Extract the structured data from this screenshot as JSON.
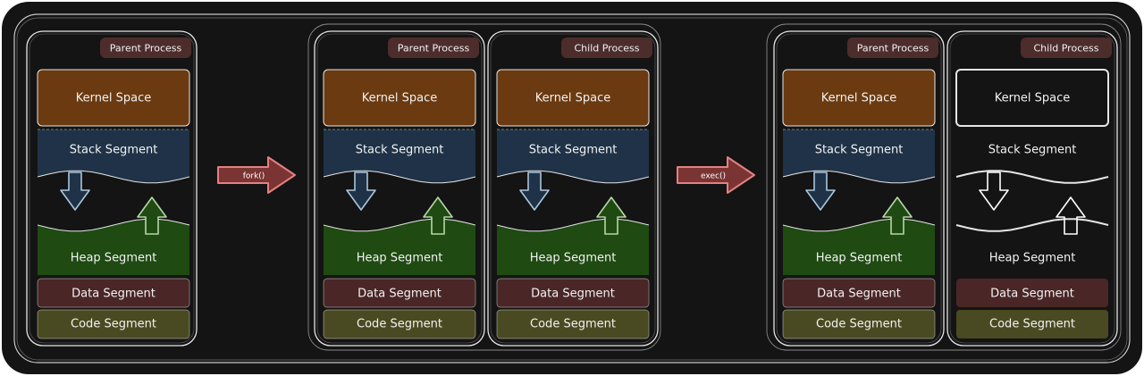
{
  "colors": {
    "background": "#141414",
    "stroke": "#e6e6e6",
    "kernel": "#6b3a10",
    "stack": "#1f3247",
    "heap": "#1f4a12",
    "data": "#4a2626",
    "code": "#4a4a22",
    "tag": "#4d2c2c",
    "arrow_fill": "#7a3434",
    "arrow_stroke": "#e58080",
    "down_arrow": "#a9c6de",
    "up_arrow": "#b6d6a8"
  },
  "tags": {
    "parent": "Parent Process",
    "child": "Child Process"
  },
  "segments": {
    "kernel": "Kernel Space",
    "stack": "Stack Segment",
    "heap": "Heap Segment",
    "data": "Data Segment",
    "code": "Code Segment"
  },
  "transitions": {
    "fork": "fork()",
    "exec": "exec()"
  },
  "processes": [
    {
      "id": "p1",
      "tag": "parent",
      "style": "filled"
    },
    {
      "id": "p2",
      "tag": "parent",
      "style": "filled"
    },
    {
      "id": "p3",
      "tag": "child",
      "style": "filled"
    },
    {
      "id": "p4",
      "tag": "parent",
      "style": "filled"
    },
    {
      "id": "p5",
      "tag": "child",
      "style": "empty"
    }
  ]
}
